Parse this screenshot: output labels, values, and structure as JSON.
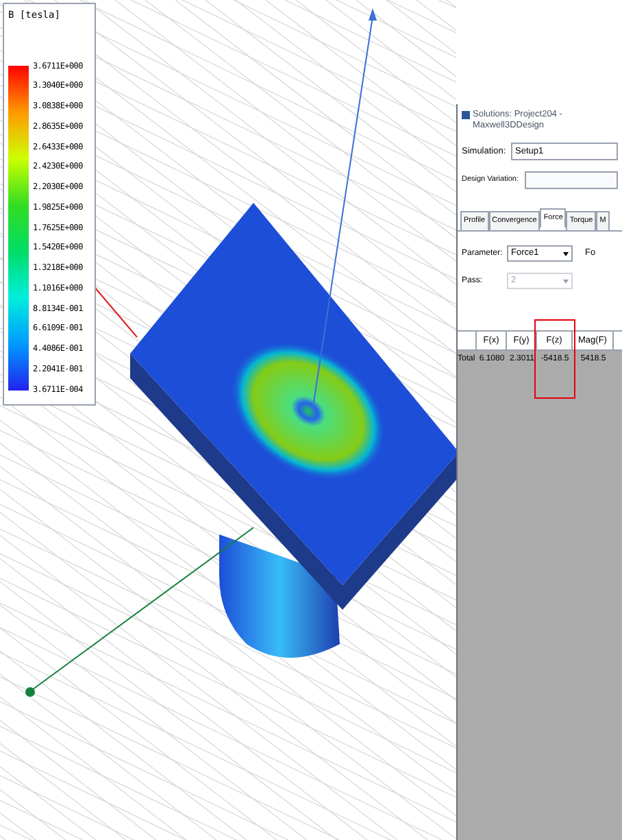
{
  "legend": {
    "title": "B [tesla]",
    "values": [
      "3.6711E+000",
      "3.3040E+000",
      "3.0838E+000",
      "2.8635E+000",
      "2.6433E+000",
      "2.4230E+000",
      "2.2030E+000",
      "1.9825E+000",
      "1.7625E+000",
      "1.5420E+000",
      "1.3218E+000",
      "1.1016E+000",
      "8.8134E-001",
      "6.6109E-001",
      "4.4086E-001",
      "2.2041E-001",
      "3.6711E-004"
    ]
  },
  "solutions_window": {
    "title": "Solutions: Project204 - Maxwell3DDesign",
    "simulation": {
      "label": "Simulation:",
      "value": "Setup1"
    },
    "design_variation": {
      "label": "Design Variation:"
    },
    "tabs": [
      {
        "label": "Profile",
        "selected": false
      },
      {
        "label": "Convergence",
        "selected": false
      },
      {
        "label": "Force",
        "selected": true
      },
      {
        "label": "Torque",
        "selected": false
      },
      {
        "label": "M",
        "selected": false
      }
    ],
    "parameter": {
      "label": "Parameter:",
      "value": "Force1"
    },
    "side_label": "Fo",
    "pass": {
      "label": "Pass:",
      "value": "2",
      "disabled": true
    },
    "table": {
      "columns": [
        {
          "label": "F(x)",
          "highlighted": false
        },
        {
          "label": "F(y)",
          "highlighted": false
        },
        {
          "label": "F(z)",
          "highlighted": true
        },
        {
          "label": "Mag(F)",
          "highlighted": false
        }
      ],
      "rows": [
        {
          "label": "Total",
          "cells": [
            "6.1080",
            "2.3011",
            "-5418.5",
            "5418.5"
          ]
        }
      ]
    }
  }
}
